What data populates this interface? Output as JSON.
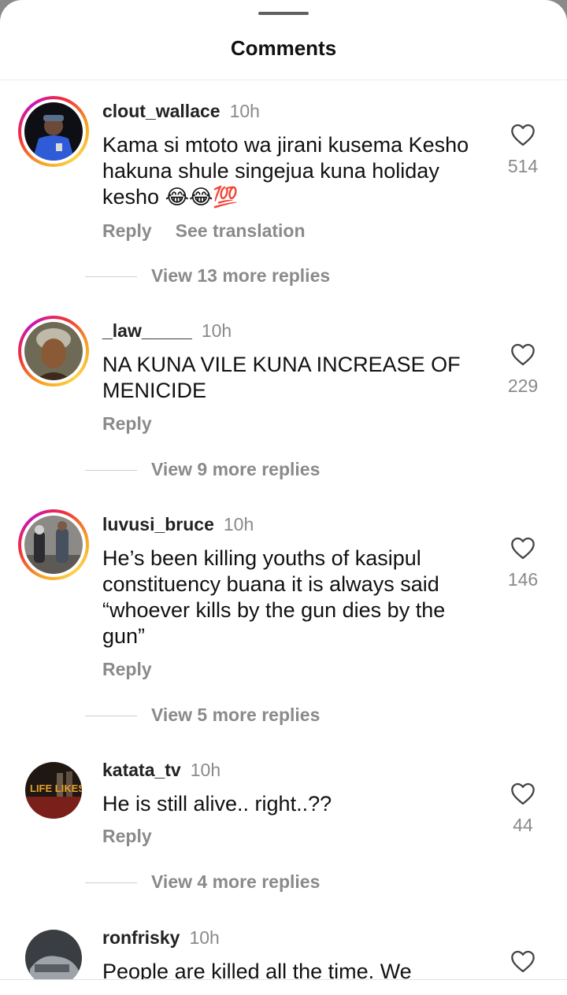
{
  "header": {
    "title": "Comments"
  },
  "comments": [
    {
      "username": "clout_wallace",
      "time": "10h",
      "text": "Kama si mtoto wa jirani kusema Kesho hakuna shule singejua kuna holiday kesho",
      "emoji": "😂😂💯",
      "reply_label": "Reply",
      "translate_label": "See translation",
      "likes": "514",
      "view_replies": "View 13 more replies",
      "has_story_ring": true
    },
    {
      "username": "_law_____",
      "time": "10h",
      "text": "NA KUNA VILE KUNA INCREASE OF MENICIDE",
      "reply_label": "Reply",
      "likes": "229",
      "view_replies": "View 9 more replies",
      "has_story_ring": true
    },
    {
      "username": "luvusi_bruce",
      "time": "10h",
      "text": "He’s been killing youths of kasipul constituency buana it is always said “whoever kills by the gun dies by the gun”",
      "reply_label": "Reply",
      "likes": "146",
      "view_replies": "View 5 more replies",
      "has_story_ring": true
    },
    {
      "username": "katata_tv",
      "time": "10h",
      "text": "He is still alive.. right..??",
      "reply_label": "Reply",
      "likes": "44",
      "view_replies": "View 4 more replies",
      "has_story_ring": false,
      "avatar_text": "LIFE LIKES"
    },
    {
      "username": "ronfrisky",
      "time": "10h",
      "text": "People are killed all the time. We",
      "has_story_ring": false
    }
  ],
  "colors": {
    "muted": "#8a8a8a",
    "ring_start": "#f5a623",
    "ring_mid": "#f0303a",
    "ring_end": "#c913b9"
  }
}
